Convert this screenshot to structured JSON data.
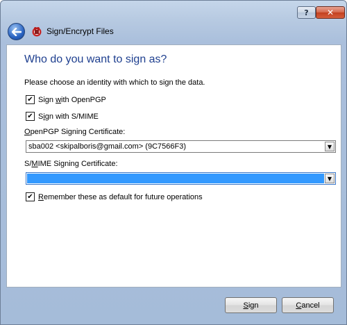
{
  "window": {
    "help_label": "?",
    "close_label": "✕"
  },
  "wizard": {
    "title": "Sign/Encrypt Files",
    "icons": {
      "back": "back-arrow-icon",
      "app": "kleopatra-app-icon"
    }
  },
  "page": {
    "heading": "Who do you want to sign as?",
    "instructions": "Please choose an identity with which to sign the data.",
    "checkboxes": [
      {
        "pre": "Sign ",
        "mnemonic": "w",
        "post": "ith OpenPGP",
        "checked": true
      },
      {
        "pre": "S",
        "mnemonic": "i",
        "post": "gn with S/MIME",
        "checked": true
      },
      {
        "pre": "",
        "mnemonic": "R",
        "post": "emember these as default for future operations",
        "checked": true
      }
    ],
    "openpgp_label": {
      "pre": "",
      "mnemonic": "O",
      "post": "penPGP Signing Certificate:"
    },
    "openpgp_value": "sba002 <skipalboris@gmail.com> (9C7566F3)",
    "smime_label": {
      "pre": "S/",
      "mnemonic": "M",
      "post": "IME Signing Certificate:"
    },
    "smime_value": ""
  },
  "buttons": {
    "sign": {
      "pre": "",
      "mnemonic": "S",
      "post": "ign"
    },
    "cancel": {
      "pre": "",
      "mnemonic": "C",
      "post": "ancel"
    }
  },
  "colors": {
    "heading": "#1e3f8f",
    "selection": "#3399ff",
    "close_button": "#c2401f"
  }
}
